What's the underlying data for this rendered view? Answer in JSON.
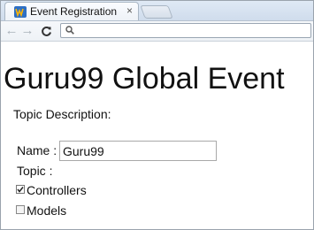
{
  "browser": {
    "tab": {
      "title": "Event Registration",
      "close_glyph": "×",
      "favicon": "page-favicon"
    },
    "toolbar": {
      "back_glyph": "←",
      "forward_glyph": "→",
      "reload_glyph": "C",
      "url": "",
      "url_placeholder": ""
    }
  },
  "page": {
    "heading": "Guru99 Global Event",
    "topic_description_label": "Topic Description:",
    "name_label": "Name :",
    "name_value": "Guru99",
    "topic_label": "Topic :",
    "checkboxes": [
      {
        "label": "Controllers",
        "checked": true
      },
      {
        "label": "Models",
        "checked": false
      }
    ]
  },
  "colors": {
    "tabstrip": "#cfdcec",
    "toolbar": "#eef2f6",
    "text": "#111111"
  }
}
